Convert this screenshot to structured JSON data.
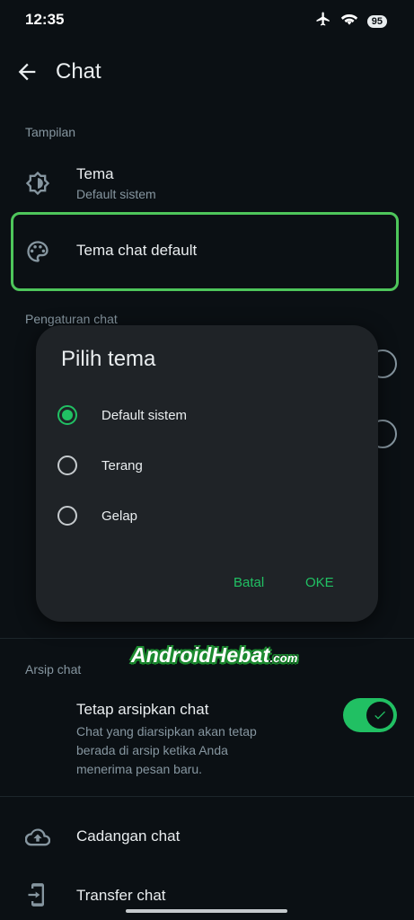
{
  "status_bar": {
    "time": "12:35",
    "battery": "95"
  },
  "header": {
    "title": "Chat"
  },
  "display_section": {
    "label": "Tampilan",
    "theme": {
      "title": "Tema",
      "subtitle": "Default sistem"
    },
    "default_chat_theme": {
      "title": "Tema chat default"
    }
  },
  "chat_settings_section": {
    "label": "Pengaturan chat"
  },
  "dialog": {
    "title": "Pilih tema",
    "options": [
      {
        "label": "Default sistem",
        "selected": true
      },
      {
        "label": "Terang",
        "selected": false
      },
      {
        "label": "Gelap",
        "selected": false
      }
    ],
    "cancel_label": "Batal",
    "ok_label": "OKE"
  },
  "watermark": {
    "main": "AndroidHebat",
    "suffix": ".com"
  },
  "archive_section": {
    "label": "Arsip chat",
    "keep_archived": {
      "title": "Tetap arsipkan chat",
      "description": "Chat yang diarsipkan akan tetap berada di arsip ketika Anda menerima pesan baru.",
      "enabled": true
    }
  },
  "backup": {
    "label": "Cadangan chat"
  },
  "transfer": {
    "label": "Transfer chat"
  },
  "colors": {
    "accent": "#21c063",
    "highlight": "#4ec65b",
    "background": "#0b1014",
    "dialog": "#1f2327"
  }
}
